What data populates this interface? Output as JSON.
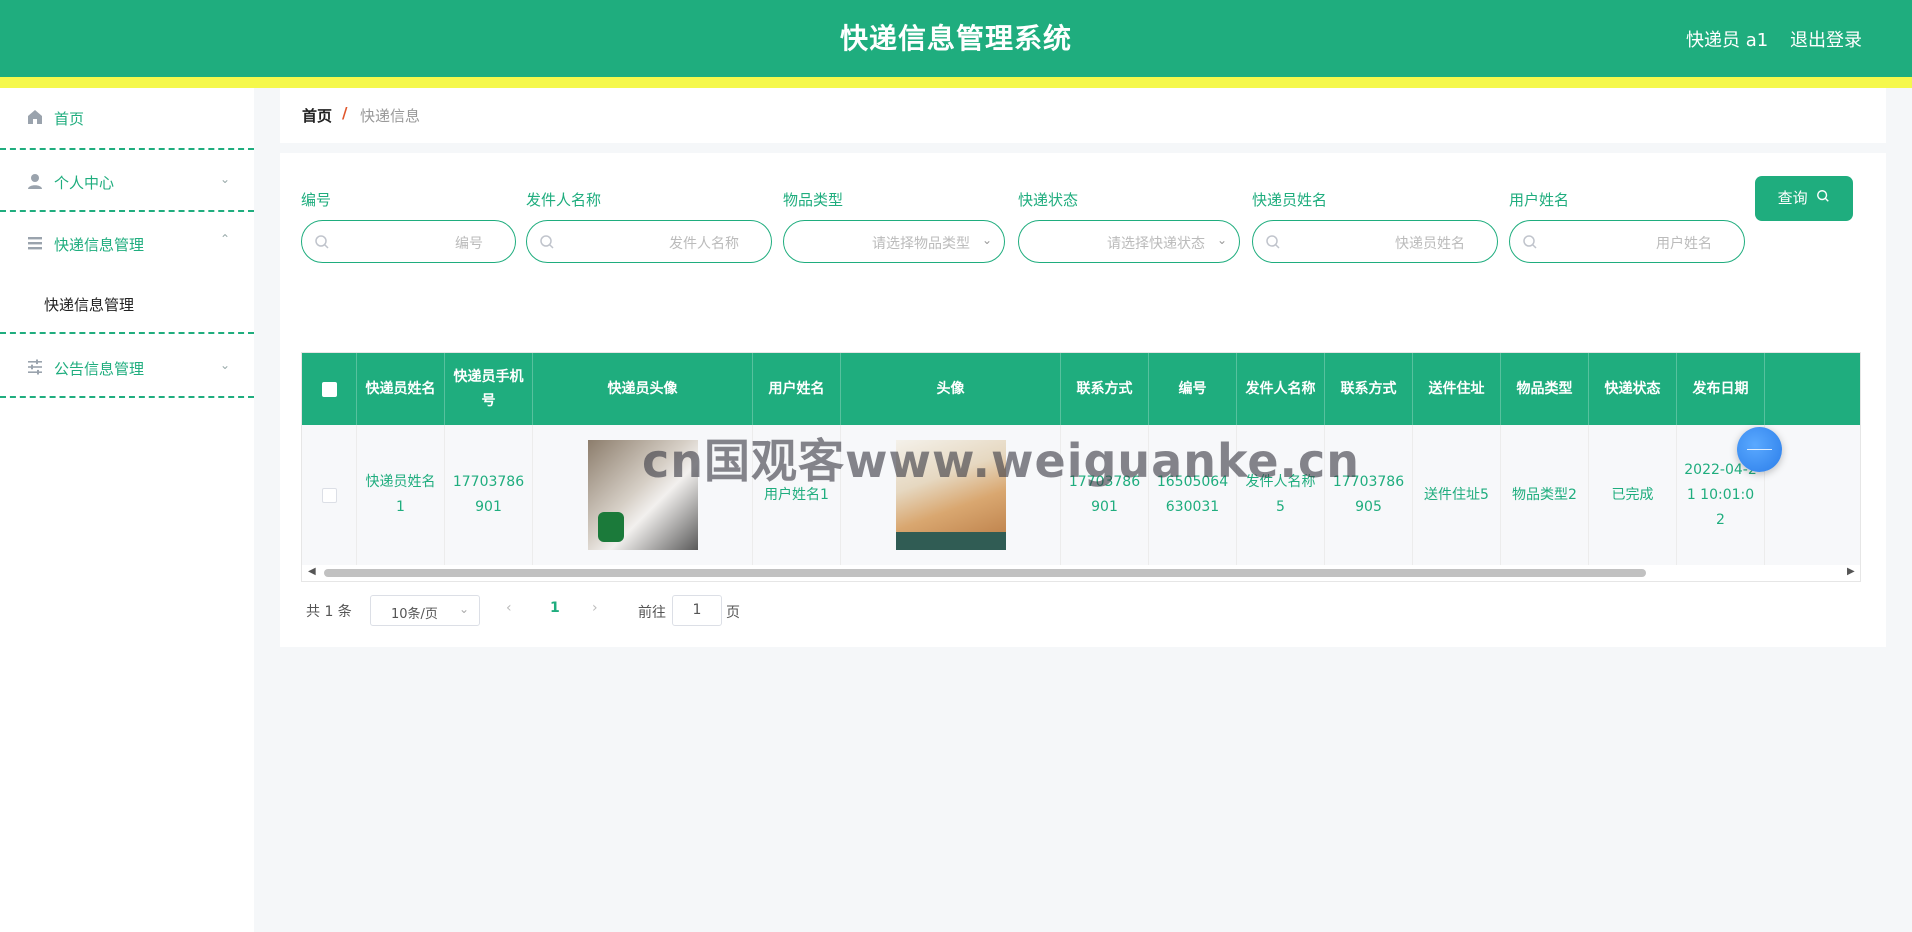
{
  "header": {
    "title": "快递信息管理系统",
    "user_label": "快递员 a1",
    "logout_label": "退出登录",
    "colors": {
      "primary": "#1fad7e",
      "strip": "#f5f84c"
    }
  },
  "sidebar": {
    "items": [
      {
        "label": "首页",
        "icon": "home-icon"
      },
      {
        "label": "个人中心",
        "icon": "user-icon",
        "arrow": "chevron-down-icon"
      },
      {
        "label": "快递信息管理",
        "icon": "list-icon",
        "arrow": "chevron-up-icon",
        "expanded": true
      },
      {
        "label": "公告信息管理",
        "icon": "sliders-icon",
        "arrow": "chevron-down-icon"
      }
    ],
    "submenu": [
      {
        "label": "快递信息管理"
      }
    ]
  },
  "breadcrumb": {
    "home": "首页",
    "separator": "/",
    "current": "快递信息"
  },
  "search": {
    "fields": [
      {
        "label": "编号",
        "placeholder": "编号",
        "type": "text"
      },
      {
        "label": "发件人名称",
        "placeholder": "发件人名称",
        "type": "text"
      },
      {
        "label": "物品类型",
        "placeholder": "请选择物品类型",
        "type": "select"
      },
      {
        "label": "快递状态",
        "placeholder": "请选择快递状态",
        "type": "select"
      },
      {
        "label": "快递员姓名",
        "placeholder": "快递员姓名",
        "type": "text"
      },
      {
        "label": "用户姓名",
        "placeholder": "用户姓名",
        "type": "text"
      }
    ],
    "query_label": "查询"
  },
  "table": {
    "columns": [
      "快递员姓名",
      "快递员手机号",
      "快递员头像",
      "用户姓名",
      "头像",
      "联系方式",
      "编号",
      "发件人名称",
      "联系方式",
      "送件住址",
      "物品类型",
      "快递状态",
      "发布日期"
    ],
    "rows": [
      {
        "courier_name": "快递员姓名1",
        "courier_phone": "17703786901",
        "courier_avatar": "cat-photo",
        "user_name": "用户姓名1",
        "avatar": "cat-photo",
        "contact": "17703786901",
        "number": "16505064630031",
        "sender_name": "发件人名称5",
        "sender_contact": "17703786905",
        "address": "送件住址5",
        "item_type": "物品类型2",
        "status": "已完成",
        "publish_date": "2022-04-21 10:01:02"
      }
    ]
  },
  "pagination": {
    "total_text": "共 1 条",
    "page_size": "10条/页",
    "current_page": "1",
    "goto_label": "前往",
    "goto_value": "1",
    "page_unit": "页"
  },
  "watermark": "cn国观客www.weiguanke.cn"
}
